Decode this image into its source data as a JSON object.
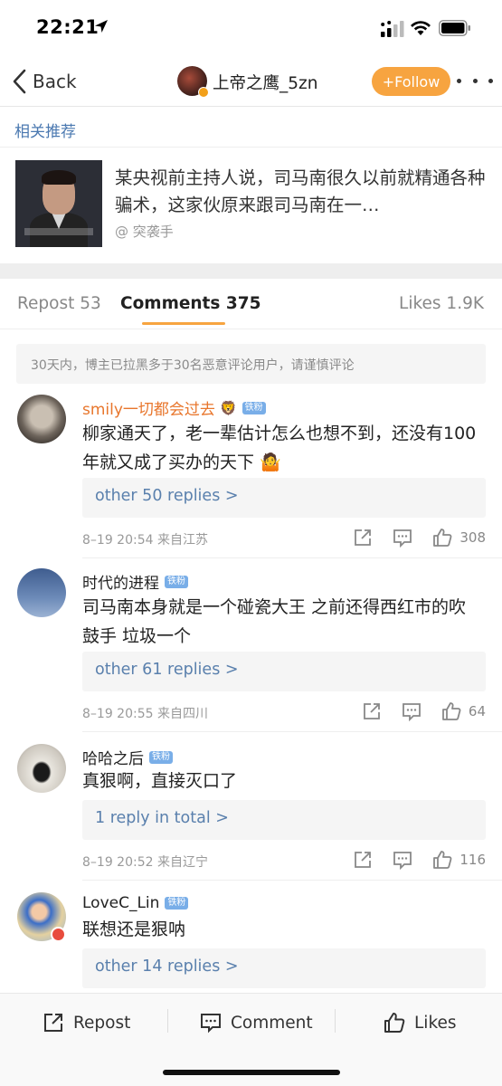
{
  "status": {
    "time": "22:21"
  },
  "nav": {
    "back_label": "Back",
    "username": "上帝之鹰_5zn",
    "follow_label": "+Follow"
  },
  "related": {
    "section_label": "相关推荐",
    "title": "某央视前主持人说，司马南很久以前就精通各种骗术，这家伙原来跟司马南在一…",
    "author": "@ 突袭手"
  },
  "tabs": {
    "repost": "Repost 53",
    "comments": "Comments 375",
    "likes": "Likes 1.9K"
  },
  "notice": "30天内，博主已拉黑多于30名恶意评论用户，请谨慎评论",
  "comments": [
    {
      "name": "smily一切都会过去",
      "badge": "铁粉",
      "text": "柳家通天了，老一辈估计怎么也想不到，还没有100年就又成了买办的天下",
      "replies": "other 50 replies >",
      "meta": "8–19 20:54  来自江苏",
      "likes": "308",
      "name_color": "#e8762c"
    },
    {
      "name": "时代的进程",
      "badge": "铁粉",
      "text": "司马南本身就是一个碰瓷大王  之前还得西红市的吹鼓手  垃圾一个",
      "replies": "other 61 replies >",
      "meta": "8–19 20:55  来自四川",
      "likes": "64",
      "name_color": "#333333"
    },
    {
      "name": "哈哈之后",
      "badge": "铁粉",
      "text": "真狠啊，直接灭口了",
      "replies": "1 reply in total >",
      "meta": "8–19 20:52  来自辽宁",
      "likes": "116",
      "name_color": "#333333"
    },
    {
      "name": "LoveC_Lin",
      "badge": "铁粉",
      "text": "联想还是狠呐",
      "replies": "other 14 replies >",
      "name_color": "#333333"
    }
  ],
  "toolbar": {
    "repost": "Repost",
    "comment": "Comment",
    "likes": "Likes"
  },
  "colors": {
    "accent_orange": "#f7a440",
    "link_blue": "#5a80ad",
    "badge_blue": "#79aee8"
  }
}
